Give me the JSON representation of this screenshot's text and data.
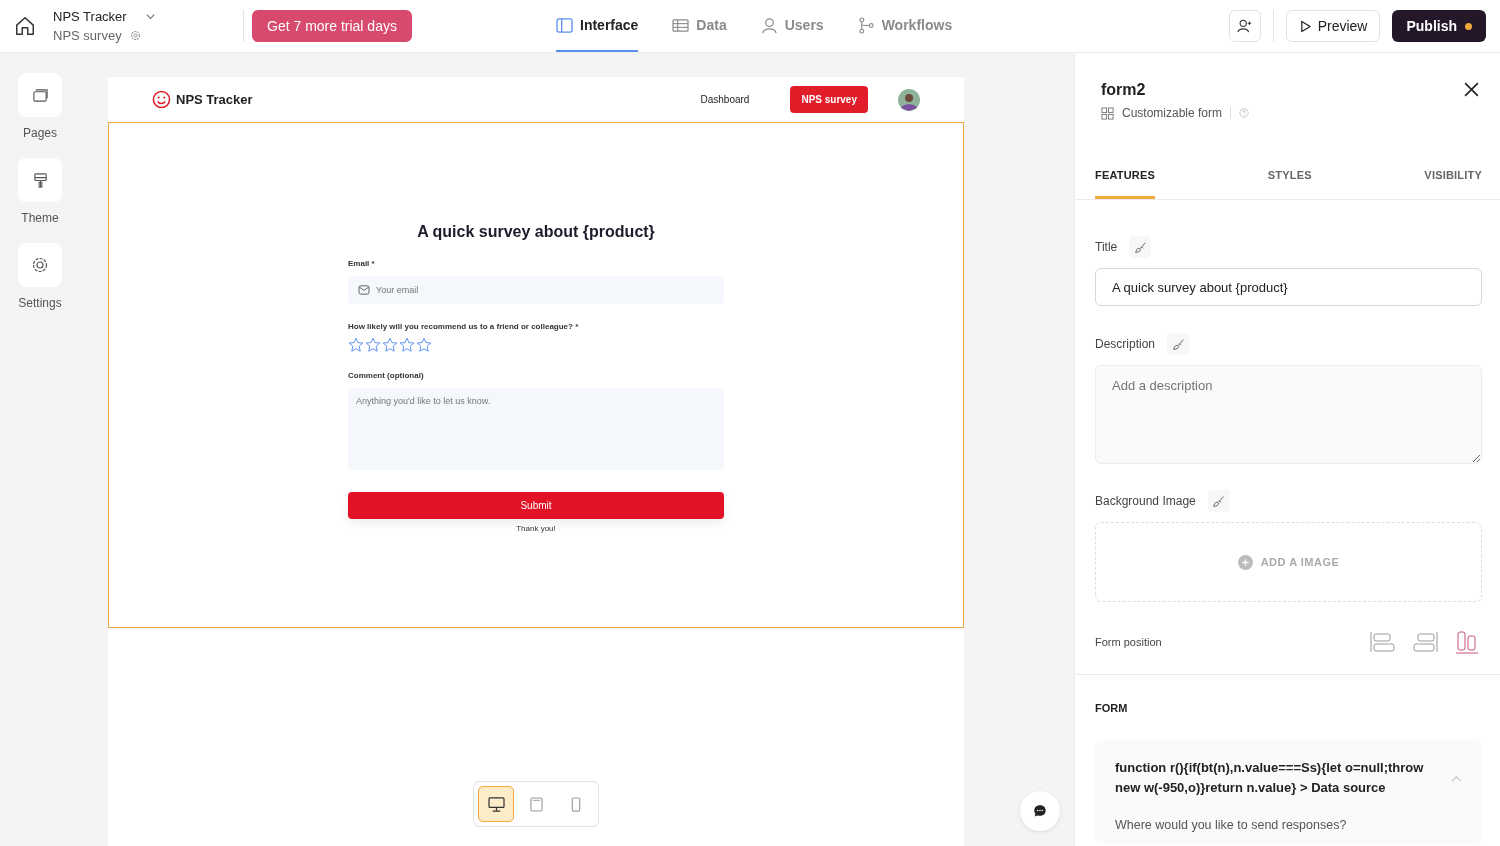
{
  "app": {
    "name": "NPS Tracker",
    "page": "NPS survey"
  },
  "trial_button": "Get 7 more trial days",
  "nav_tabs": [
    {
      "label": "Interface",
      "kind": "interface",
      "selected": true
    },
    {
      "label": "Data",
      "kind": "data",
      "selected": false
    },
    {
      "label": "Users",
      "kind": "users",
      "selected": false
    },
    {
      "label": "Workflows",
      "kind": "workflows",
      "selected": false
    }
  ],
  "preview_button": "Preview",
  "publish_button": {
    "label": "Publish",
    "pending": true
  },
  "sidebar": {
    "items": [
      {
        "label": "Pages",
        "kind": "pages"
      },
      {
        "label": "Theme",
        "kind": "theme"
      },
      {
        "label": "Settings",
        "kind": "settings"
      }
    ]
  },
  "preview": {
    "brand": "NPS Tracker",
    "nav": [
      {
        "label": "Dashboard",
        "selected": false
      },
      {
        "label": "NPS survey",
        "selected": true
      }
    ],
    "form": {
      "selected": true,
      "title": "A quick survey about {product}",
      "fields": [
        {
          "kind": "email",
          "label": "Email *",
          "placeholder": "Your email"
        },
        {
          "kind": "rating",
          "label": "How likely will you recommend us to a friend or colleague? *",
          "stars": 0
        },
        {
          "kind": "textarea",
          "label": "Comment (optional)",
          "placeholder": "Anything you'd like to let us know."
        }
      ],
      "submit": "Submit",
      "success_message": "Thank you!"
    }
  },
  "devices": [
    {
      "kind": "desktop",
      "selected": true
    },
    {
      "kind": "tablet",
      "selected": false
    },
    {
      "kind": "mobile",
      "selected": false
    }
  ],
  "panel": {
    "title": "form2",
    "subtitle": "Customizable form",
    "tabs": [
      {
        "label": "FEATURES",
        "selected": true
      },
      {
        "label": "STYLES",
        "selected": false
      },
      {
        "label": "VISIBILITY",
        "selected": false
      }
    ],
    "title_field": {
      "label": "Title",
      "value": "A quick survey about {product}"
    },
    "description_field": {
      "label": "Description",
      "placeholder": "Add a description"
    },
    "background_image": {
      "label": "Background Image",
      "button": "ADD A IMAGE"
    },
    "form_position": {
      "label": "Form position",
      "options": [
        {
          "kind": "left",
          "selected": false
        },
        {
          "kind": "right",
          "selected": false
        },
        {
          "kind": "center",
          "selected": true
        }
      ]
    },
    "form_section": {
      "heading": "FORM",
      "source": "function r(){if(bt(n),n.value===Ss){let o=null;throw new w(-950,o)}return n.value} > Data source",
      "question": "Where would you like to send responses?",
      "expanded": true
    }
  }
}
